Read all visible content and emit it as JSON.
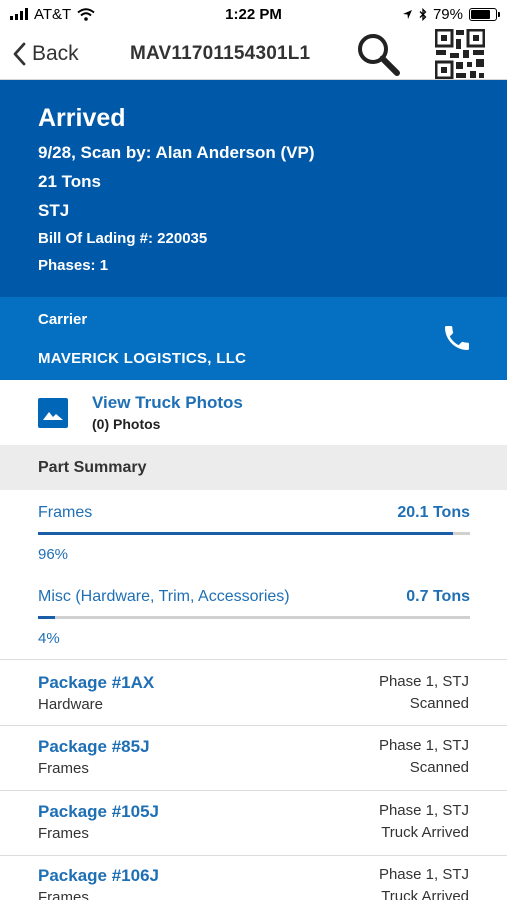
{
  "status_bar": {
    "carrier": "AT&T",
    "time": "1:22 PM",
    "battery": "79%",
    "battery_level": 0.79
  },
  "nav": {
    "back_label": "Back",
    "title": "MAV11701154301L1",
    "search_icon": "search-icon",
    "qr_icon": "qr-code-icon"
  },
  "status": {
    "title": "Arrived",
    "scan_line": "9/28, Scan by: Alan Anderson (VP)",
    "weight": "21 Tons",
    "location": "STJ",
    "bill_of_lading": "Bill Of Lading #: 220035",
    "phases": "Phases: 1"
  },
  "carrier": {
    "label": "Carrier",
    "name": "MAVERICK LOGISTICS, LLC",
    "phone_icon": "phone-icon"
  },
  "photos": {
    "link": "View Truck Photos",
    "count": "(0) Photos"
  },
  "part_summary": {
    "header": "Part Summary",
    "parts": [
      {
        "name": "Frames",
        "weight": "20.1 Tons",
        "percent": "96%",
        "fraction": 0.96
      },
      {
        "name": "Misc (Hardware, Trim, Accessories)",
        "weight": "0.7 Tons",
        "percent": "4%",
        "fraction": 0.04
      }
    ]
  },
  "packages": [
    {
      "title": "Package #1AX",
      "type": "Hardware",
      "phase": "Phase 1, STJ",
      "status": "Scanned"
    },
    {
      "title": "Package #85J",
      "type": "Frames",
      "phase": "Phase 1, STJ",
      "status": "Scanned"
    },
    {
      "title": "Package #105J",
      "type": "Frames",
      "phase": "Phase 1, STJ",
      "status": "Truck Arrived"
    },
    {
      "title": "Package #106J",
      "type": "Frames",
      "phase": "Phase 1, STJ",
      "status": "Truck Arrived"
    }
  ],
  "colors": {
    "status_bg": "#0058a8",
    "carrier_bg": "#0570c1",
    "link": "#1f6fb5",
    "summary_bg": "#ececec"
  }
}
